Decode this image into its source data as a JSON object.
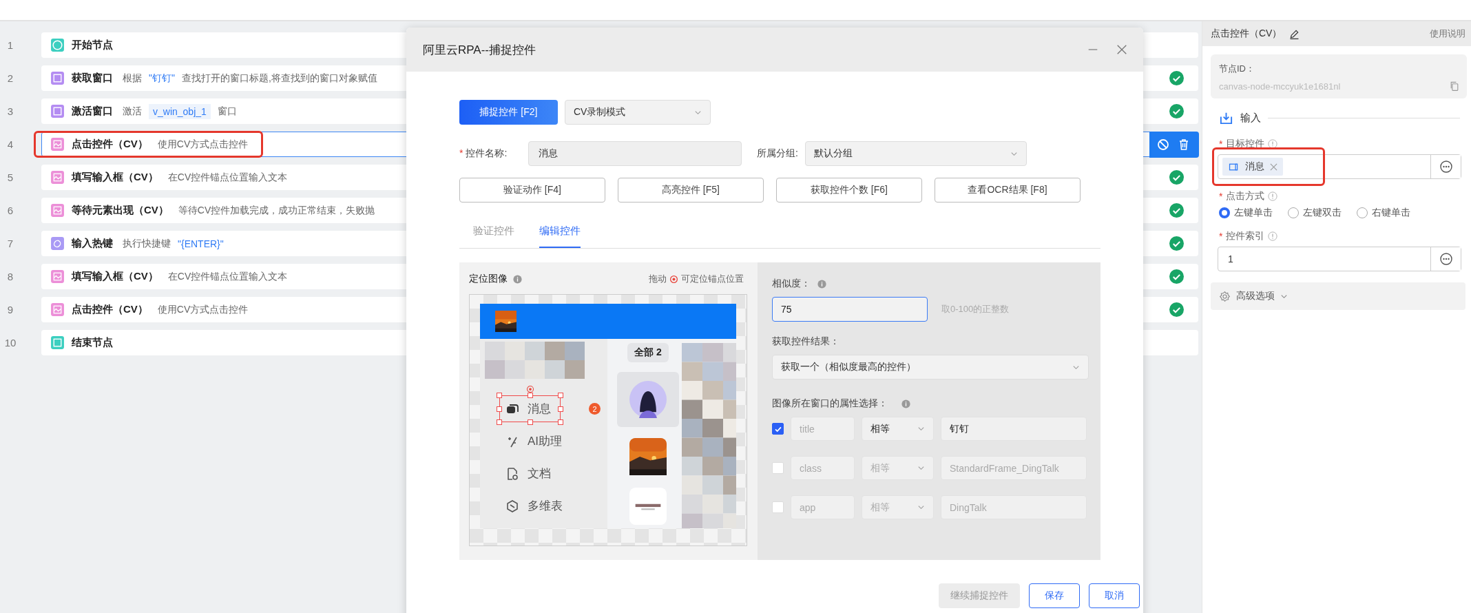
{
  "steps": [
    {
      "num": "1",
      "kind": "start",
      "title": "开始节点",
      "done": false,
      "selected": false,
      "highlighted": false
    },
    {
      "num": "2",
      "kind": "window",
      "title": "获取窗口",
      "desc": [
        {
          "kind": "plain",
          "text": "根据"
        },
        {
          "kind": "string",
          "text": "\"钉钉\""
        },
        {
          "kind": "plain",
          "text": "查找打开的窗口标题,将查找到的窗口对象赋值"
        }
      ],
      "done": true,
      "selected": false,
      "highlighted": false
    },
    {
      "num": "3",
      "kind": "window",
      "title": "激活窗口",
      "desc": [
        {
          "kind": "plain",
          "text": "激活"
        },
        {
          "kind": "var",
          "text": "v_win_obj_1"
        },
        {
          "kind": "plain",
          "text": "窗口"
        }
      ],
      "done": true,
      "selected": false,
      "highlighted": false
    },
    {
      "num": "4",
      "kind": "cv",
      "title": "点击控件（CV）",
      "desc": [
        {
          "kind": "plain",
          "text": "使用CV方式点击控件"
        }
      ],
      "done": false,
      "selected": true,
      "highlighted": true
    },
    {
      "num": "5",
      "kind": "cv",
      "title": "填写输入框（CV）",
      "desc": [
        {
          "kind": "plain",
          "text": "在CV控件锚点位置输入文本"
        }
      ],
      "done": true,
      "selected": false,
      "highlighted": false
    },
    {
      "num": "6",
      "kind": "cv",
      "title": "等待元素出现（CV）",
      "desc": [
        {
          "kind": "plain",
          "text": "等待CV控件加载完成，成功正常结束，失败抛"
        }
      ],
      "done": true,
      "selected": false,
      "highlighted": false
    },
    {
      "num": "7",
      "kind": "hotkey",
      "title": "输入热键",
      "desc": [
        {
          "kind": "plain",
          "text": "执行快捷键"
        },
        {
          "kind": "string",
          "text": "\"{ENTER}\""
        }
      ],
      "done": true,
      "selected": false,
      "highlighted": false
    },
    {
      "num": "8",
      "kind": "cv",
      "title": "填写输入框（CV）",
      "desc": [
        {
          "kind": "plain",
          "text": "在CV控件锚点位置输入文本"
        }
      ],
      "done": true,
      "selected": false,
      "highlighted": false
    },
    {
      "num": "9",
      "kind": "cv",
      "title": "点击控件（CV）",
      "desc": [
        {
          "kind": "plain",
          "text": "使用CV方式点击控件"
        }
      ],
      "done": true,
      "selected": false,
      "highlighted": false
    },
    {
      "num": "10",
      "kind": "end",
      "title": "结束节点",
      "done": false,
      "selected": false,
      "highlighted": false
    }
  ],
  "dialog": {
    "title": "阿里云RPA--捕捉控件",
    "capture_button": "捕捉控件 [F2]",
    "mode_select": "CV录制模式",
    "name_label": "控件名称:",
    "name_required_mark": "*",
    "name_value": "消息",
    "group_label": "所属分组:",
    "group_value": "默认分组",
    "actions": [
      "验证动作 [F4]",
      "高亮控件 [F5]",
      "获取控件个数 [F6]",
      "查看OCR结果 [F8]"
    ],
    "tabs": [
      {
        "label": "验证控件",
        "selected": false
      },
      {
        "label": "编辑控件",
        "selected": true
      }
    ],
    "image_panel": {
      "label": "定位图像",
      "hint_before": "拖动",
      "hint_after": "可定位锚点位置",
      "nav": [
        {
          "kind": "chat",
          "label": "消息",
          "badge": "2",
          "captured": true
        },
        {
          "kind": "ai",
          "label": "AI助理",
          "captured": false
        },
        {
          "kind": "doc",
          "label": "文档",
          "captured": false
        },
        {
          "kind": "table",
          "label": "多维表",
          "captured": false
        }
      ],
      "filter": "全部 2"
    },
    "similarity": {
      "label": "相似度：",
      "value": "75",
      "hint": "取0-100的正整数"
    },
    "result": {
      "label": "获取控件结果：",
      "value": "获取一个（相似度最高的控件）"
    },
    "attrs_label": "图像所在窗口的属性选择：",
    "attrs": [
      {
        "checked": true,
        "key": "title",
        "op": "相等",
        "value": "钉钉"
      },
      {
        "checked": false,
        "key": "class",
        "op": "相等",
        "value": "StandardFrame_DingTalk"
      },
      {
        "checked": false,
        "key": "app",
        "op": "相等",
        "value": "DingTalk"
      }
    ],
    "footer": [
      {
        "label": "继续捕捉控件",
        "disabled": true
      },
      {
        "label": "保存",
        "disabled": false
      },
      {
        "label": "取消",
        "disabled": false
      }
    ]
  },
  "panel": {
    "title": "点击控件（CV）",
    "help": "使用说明",
    "node_id_label": "节点ID：",
    "node_id": "canvas-node-mccyuk1e1681nl",
    "section": "输入",
    "target": {
      "label": "目标控件",
      "required_mark": "*",
      "tag": "消息",
      "highlighted": true
    },
    "click_mode": {
      "label": "点击方式",
      "required_mark": "*",
      "options": [
        {
          "label": "左键单击",
          "selected": true
        },
        {
          "label": "左键双击",
          "selected": false
        },
        {
          "label": "右键单击",
          "selected": false
        }
      ]
    },
    "index": {
      "label": "控件索引",
      "required_mark": "*",
      "value": "1"
    },
    "advanced": {
      "label": "高级选项"
    }
  }
}
